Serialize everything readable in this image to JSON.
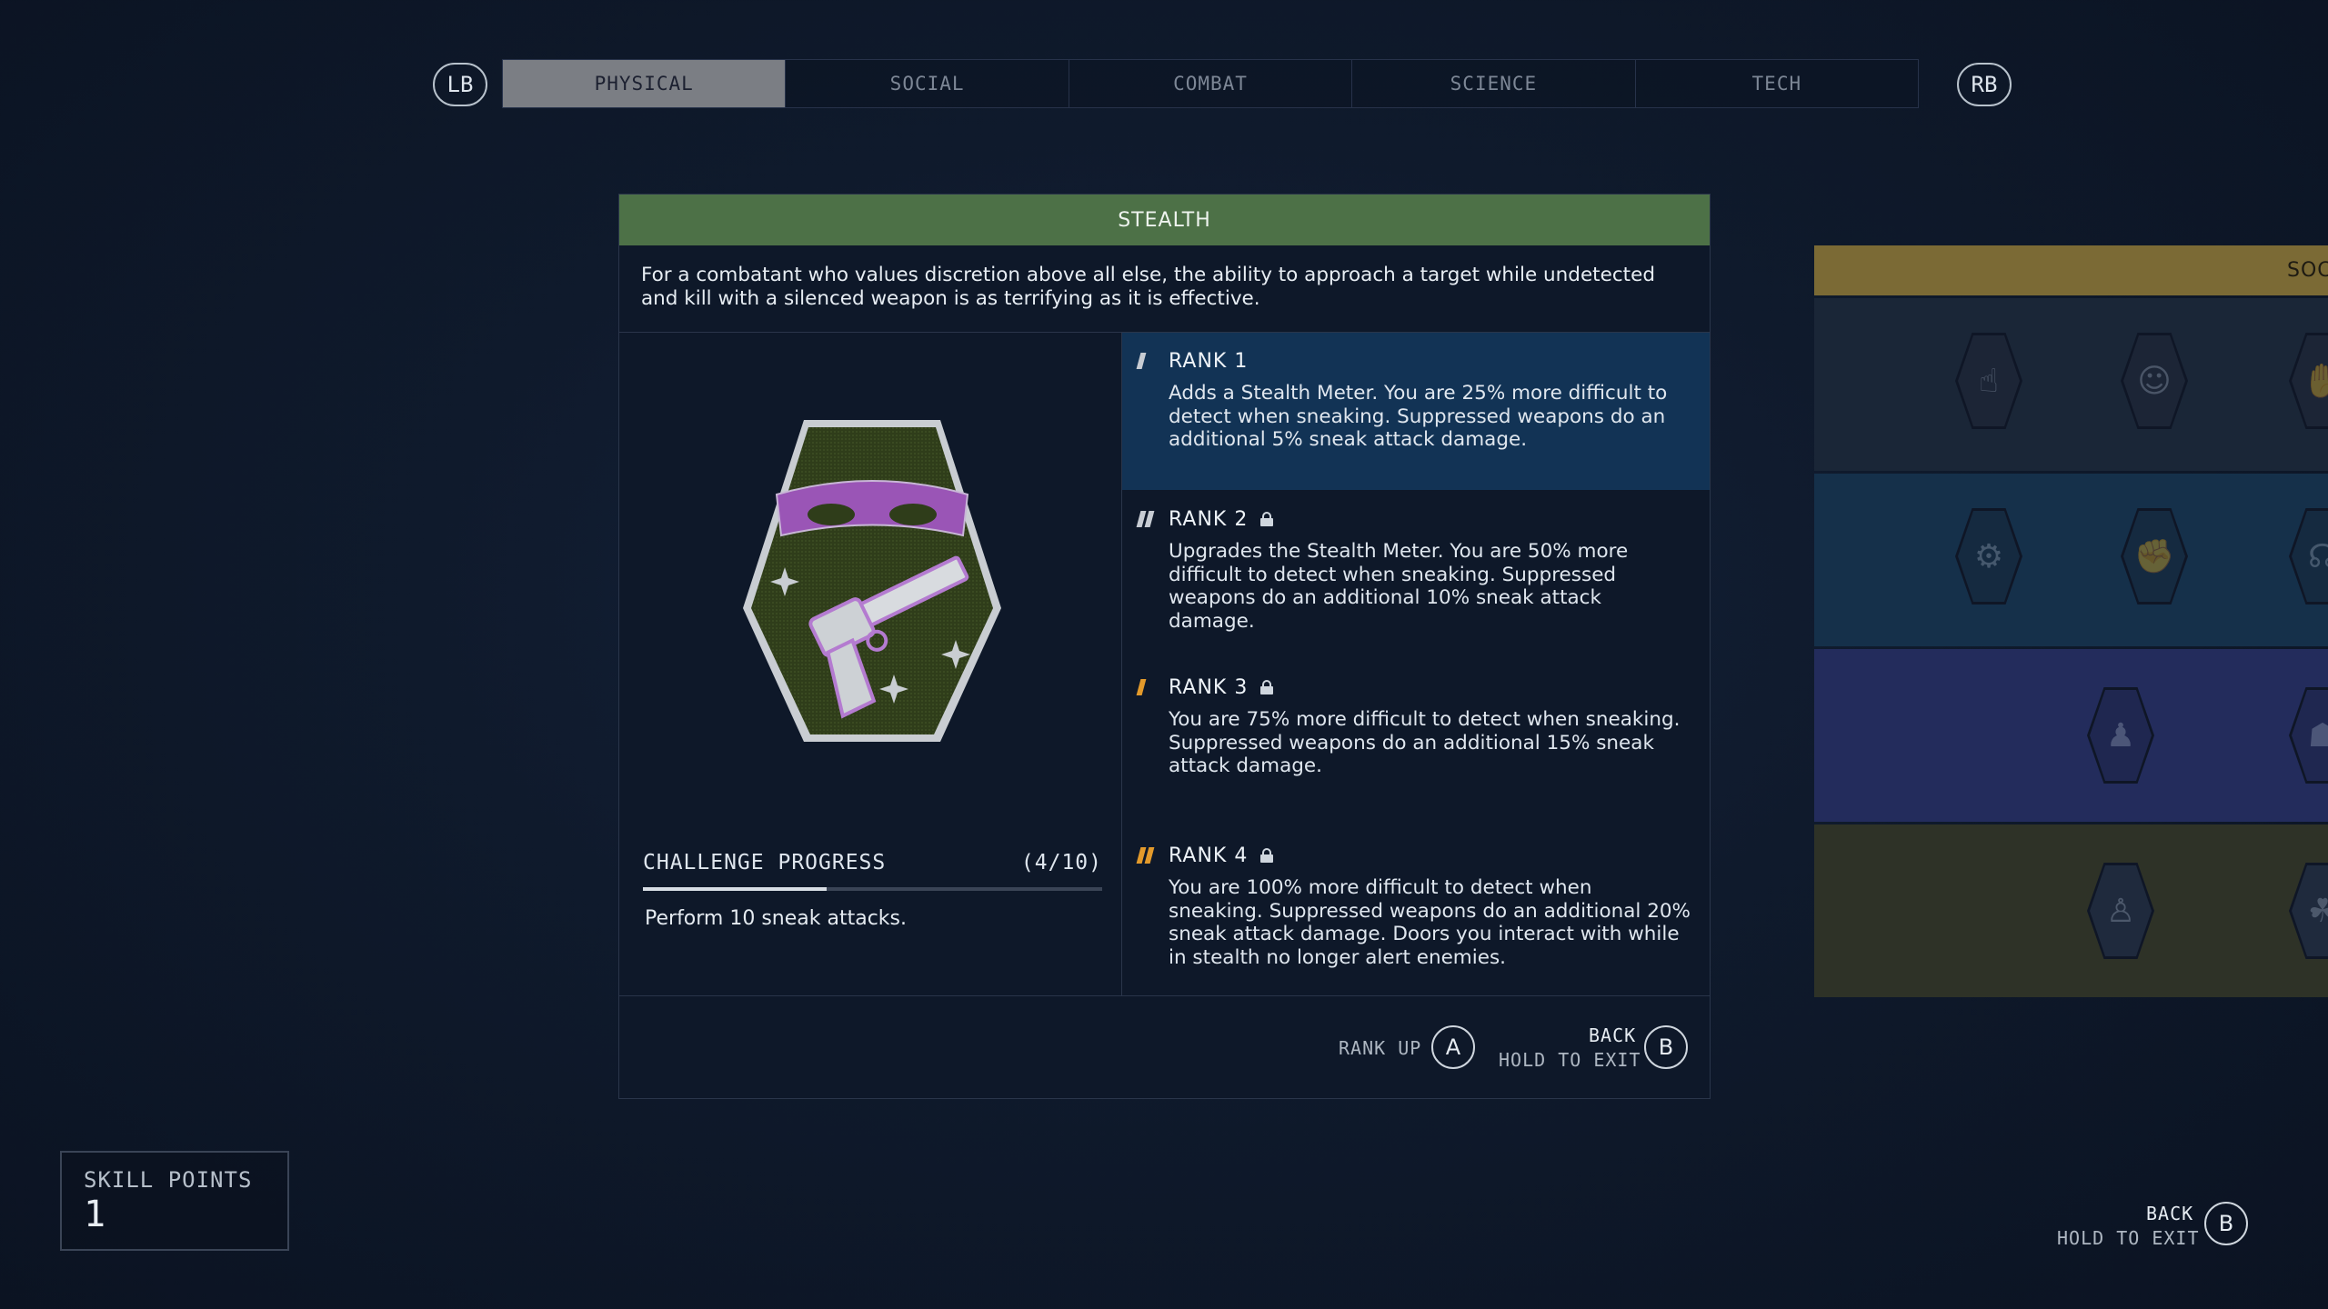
{
  "nav": {
    "left_bumper": "LB",
    "right_bumper": "RB",
    "tabs": [
      {
        "label": "PHYSICAL",
        "active": true
      },
      {
        "label": "SOCIAL",
        "active": false
      },
      {
        "label": "COMBAT",
        "active": false
      },
      {
        "label": "SCIENCE",
        "active": false
      },
      {
        "label": "TECH",
        "active": false
      }
    ]
  },
  "skill": {
    "name": "STEALTH",
    "description": "For a combatant who values discretion above all else, the ability to approach a target while undetected and kill with a silenced weapon is as terrifying as it is effective.",
    "header_color": "#4d7147",
    "badge_icon": "masked-bandit-pistol-icon"
  },
  "challenge": {
    "title": "CHALLENGE PROGRESS",
    "count": "(4/10)",
    "progress_fraction": 0.4,
    "task": "Perform 10 sneak attacks."
  },
  "ranks": [
    {
      "title": "RANK 1",
      "locked": false,
      "active": true,
      "marker_color": "#c7ccd3",
      "marker_count": 1,
      "description": "Adds a Stealth Meter. You are 25% more difficult to detect when sneaking. Suppressed weapons do an additional 5% sneak attack damage."
    },
    {
      "title": "RANK 2",
      "locked": true,
      "active": false,
      "marker_color": "#c7ccd3",
      "marker_count": 2,
      "description": "Upgrades the Stealth Meter. You are 50% more difficult to detect when sneaking. Suppressed weapons do an additional 10% sneak attack damage."
    },
    {
      "title": "RANK 3",
      "locked": true,
      "active": false,
      "marker_color": "#e39a2b",
      "marker_count": 1,
      "description": "You are 75% more difficult to detect when sneaking. Suppressed weapons do an additional 15% sneak attack damage."
    },
    {
      "title": "RANK 4",
      "locked": true,
      "active": false,
      "marker_color": "#e39a2b",
      "marker_count": 2,
      "description": "You are 100% more difficult to detect when sneaking. Suppressed weapons do an additional 20% sneak attack damage. Doors you interact with while in stealth no longer alert enemies."
    }
  ],
  "footer": {
    "rank_up_label": "RANK UP",
    "rank_up_button": "A",
    "back_label": "BACK",
    "hold_label": "HOLD TO EXIT",
    "back_button": "B"
  },
  "side_panel": {
    "header": "SOC",
    "header_color": "#7b6a35",
    "rows": [
      {
        "color": "#1a2637",
        "icons": [
          "finger-gesture-icon",
          "mask-icon",
          "partial-icon"
        ]
      },
      {
        "color": "#15304a",
        "icons": [
          "robot-head-icon",
          "handshake-icon",
          "partial-icon"
        ]
      },
      {
        "color": "#232c5c",
        "icons": [
          "presenter-icon",
          "partial-icon"
        ]
      },
      {
        "color": "#2e3227",
        "icons": [
          "puppet-icon",
          "partial-icon"
        ]
      }
    ]
  },
  "skill_points": {
    "label": "SKILL POINTS",
    "value": "1"
  },
  "global_footer": {
    "back_label": "BACK",
    "hold_label": "HOLD TO EXIT",
    "back_button": "B"
  }
}
